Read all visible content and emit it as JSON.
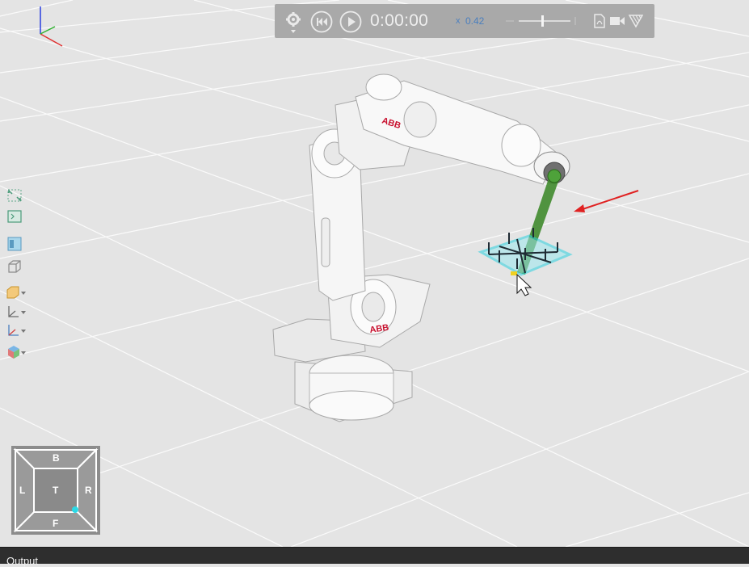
{
  "toolbar": {
    "time": "0:00:00",
    "speed_prefix": "x",
    "speed_value": "0.42",
    "icons": [
      "gear-icon",
      "rewind-icon",
      "play-icon",
      "speed-slider",
      "pdf-icon",
      "video-camera-icon",
      "web-export-icon"
    ]
  },
  "left_toolbar": {
    "icons": [
      "zoom-extents-icon",
      "fit-selection-icon",
      "view-panel-icon",
      "wireframe-box-icon",
      "shaded-box-icon",
      "axes-icon",
      "frames-icon",
      "cube-color-icon"
    ]
  },
  "viewcube": {
    "top": "B",
    "bottom": "F",
    "left": "L",
    "right": "R",
    "center": "T"
  },
  "robot": {
    "brand": "ABB"
  },
  "output": {
    "title": "Output"
  },
  "colors": {
    "toolbar_bg": "#a9a9a9",
    "floor": "#e4e4e4",
    "viewcube_bg": "#8c8c8c",
    "path_green": "#3f8a2c",
    "arrow_red": "#e02020",
    "brand_red": "#c8102e",
    "selection_cyan": "#2bd1e0"
  }
}
